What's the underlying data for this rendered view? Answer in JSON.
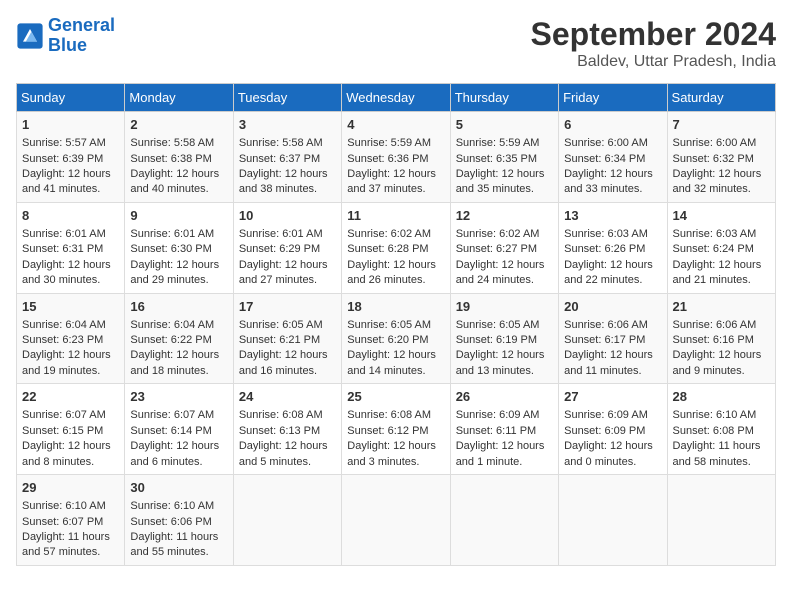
{
  "logo": {
    "line1": "General",
    "line2": "Blue"
  },
  "title": "September 2024",
  "subtitle": "Baldev, Uttar Pradesh, India",
  "days_header": [
    "Sunday",
    "Monday",
    "Tuesday",
    "Wednesday",
    "Thursday",
    "Friday",
    "Saturday"
  ],
  "weeks": [
    [
      {
        "day": "1",
        "sunrise": "5:57 AM",
        "sunset": "6:39 PM",
        "daylight": "12 hours and 41 minutes."
      },
      {
        "day": "2",
        "sunrise": "5:58 AM",
        "sunset": "6:38 PM",
        "daylight": "12 hours and 40 minutes."
      },
      {
        "day": "3",
        "sunrise": "5:58 AM",
        "sunset": "6:37 PM",
        "daylight": "12 hours and 38 minutes."
      },
      {
        "day": "4",
        "sunrise": "5:59 AM",
        "sunset": "6:36 PM",
        "daylight": "12 hours and 37 minutes."
      },
      {
        "day": "5",
        "sunrise": "5:59 AM",
        "sunset": "6:35 PM",
        "daylight": "12 hours and 35 minutes."
      },
      {
        "day": "6",
        "sunrise": "6:00 AM",
        "sunset": "6:34 PM",
        "daylight": "12 hours and 33 minutes."
      },
      {
        "day": "7",
        "sunrise": "6:00 AM",
        "sunset": "6:32 PM",
        "daylight": "12 hours and 32 minutes."
      }
    ],
    [
      {
        "day": "8",
        "sunrise": "6:01 AM",
        "sunset": "6:31 PM",
        "daylight": "12 hours and 30 minutes."
      },
      {
        "day": "9",
        "sunrise": "6:01 AM",
        "sunset": "6:30 PM",
        "daylight": "12 hours and 29 minutes."
      },
      {
        "day": "10",
        "sunrise": "6:01 AM",
        "sunset": "6:29 PM",
        "daylight": "12 hours and 27 minutes."
      },
      {
        "day": "11",
        "sunrise": "6:02 AM",
        "sunset": "6:28 PM",
        "daylight": "12 hours and 26 minutes."
      },
      {
        "day": "12",
        "sunrise": "6:02 AM",
        "sunset": "6:27 PM",
        "daylight": "12 hours and 24 minutes."
      },
      {
        "day": "13",
        "sunrise": "6:03 AM",
        "sunset": "6:26 PM",
        "daylight": "12 hours and 22 minutes."
      },
      {
        "day": "14",
        "sunrise": "6:03 AM",
        "sunset": "6:24 PM",
        "daylight": "12 hours and 21 minutes."
      }
    ],
    [
      {
        "day": "15",
        "sunrise": "6:04 AM",
        "sunset": "6:23 PM",
        "daylight": "12 hours and 19 minutes."
      },
      {
        "day": "16",
        "sunrise": "6:04 AM",
        "sunset": "6:22 PM",
        "daylight": "12 hours and 18 minutes."
      },
      {
        "day": "17",
        "sunrise": "6:05 AM",
        "sunset": "6:21 PM",
        "daylight": "12 hours and 16 minutes."
      },
      {
        "day": "18",
        "sunrise": "6:05 AM",
        "sunset": "6:20 PM",
        "daylight": "12 hours and 14 minutes."
      },
      {
        "day": "19",
        "sunrise": "6:05 AM",
        "sunset": "6:19 PM",
        "daylight": "12 hours and 13 minutes."
      },
      {
        "day": "20",
        "sunrise": "6:06 AM",
        "sunset": "6:17 PM",
        "daylight": "12 hours and 11 minutes."
      },
      {
        "day": "21",
        "sunrise": "6:06 AM",
        "sunset": "6:16 PM",
        "daylight": "12 hours and 9 minutes."
      }
    ],
    [
      {
        "day": "22",
        "sunrise": "6:07 AM",
        "sunset": "6:15 PM",
        "daylight": "12 hours and 8 minutes."
      },
      {
        "day": "23",
        "sunrise": "6:07 AM",
        "sunset": "6:14 PM",
        "daylight": "12 hours and 6 minutes."
      },
      {
        "day": "24",
        "sunrise": "6:08 AM",
        "sunset": "6:13 PM",
        "daylight": "12 hours and 5 minutes."
      },
      {
        "day": "25",
        "sunrise": "6:08 AM",
        "sunset": "6:12 PM",
        "daylight": "12 hours and 3 minutes."
      },
      {
        "day": "26",
        "sunrise": "6:09 AM",
        "sunset": "6:11 PM",
        "daylight": "12 hours and 1 minute."
      },
      {
        "day": "27",
        "sunrise": "6:09 AM",
        "sunset": "6:09 PM",
        "daylight": "12 hours and 0 minutes."
      },
      {
        "day": "28",
        "sunrise": "6:10 AM",
        "sunset": "6:08 PM",
        "daylight": "11 hours and 58 minutes."
      }
    ],
    [
      {
        "day": "29",
        "sunrise": "6:10 AM",
        "sunset": "6:07 PM",
        "daylight": "11 hours and 57 minutes."
      },
      {
        "day": "30",
        "sunrise": "6:10 AM",
        "sunset": "6:06 PM",
        "daylight": "11 hours and 55 minutes."
      },
      null,
      null,
      null,
      null,
      null
    ]
  ]
}
